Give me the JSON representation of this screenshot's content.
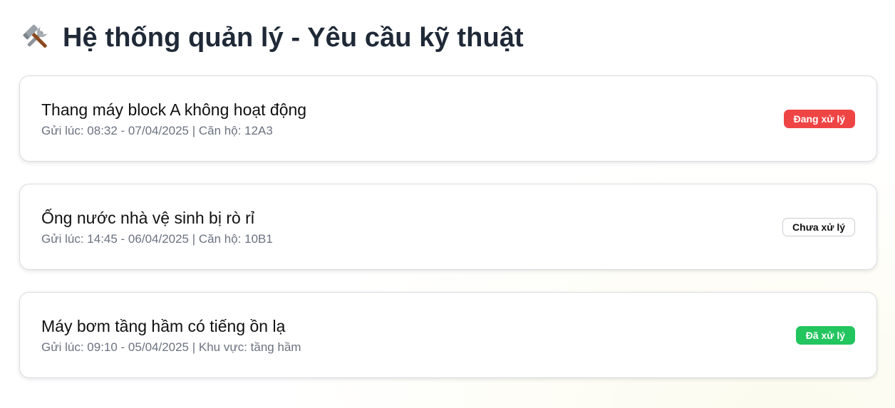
{
  "header": {
    "icon": "hammer-and-wrench-icon",
    "title": "Hệ thống quản lý - Yêu cầu kỹ thuật"
  },
  "requests": [
    {
      "title": "Thang máy block A không hoạt động",
      "meta": "Gửi lúc: 08:32 - 07/04/2025 | Căn hộ: 12A3",
      "status": "Đang xử lý",
      "status_bg": "#ef4444",
      "status_fg": "#ffffff",
      "status_border": "#ef4444"
    },
    {
      "title": "Ống nước nhà vệ sinh bị rò rỉ",
      "meta": "Gửi lúc: 14:45 - 06/04/2025 | Căn hộ: 10B1",
      "status": "Chưa xử lý",
      "status_bg": "#ffffff",
      "status_fg": "#111111",
      "status_border": "#c9ccd1"
    },
    {
      "title": "Máy bơm tầng hầm có tiếng ồn lạ",
      "meta": "Gửi lúc: 09:10 - 05/04/2025 | Khu vực: tầng hầm",
      "status": "Đã xử lý",
      "status_bg": "#22c55e",
      "status_fg": "#ffffff",
      "status_border": "#22c55e"
    }
  ]
}
